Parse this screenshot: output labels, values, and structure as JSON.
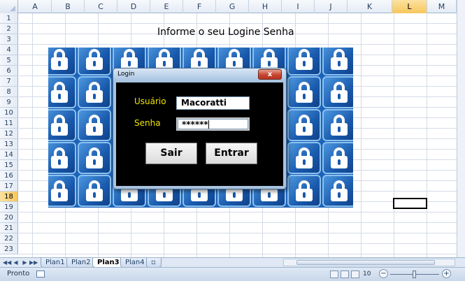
{
  "sheet": {
    "columns": [
      "A",
      "B",
      "C",
      "D",
      "E",
      "F",
      "G",
      "H",
      "I",
      "J",
      "K",
      "L",
      "M"
    ],
    "selected_column": "L",
    "rows": [
      "1",
      "2",
      "3",
      "4",
      "5",
      "6",
      "7",
      "8",
      "9",
      "10",
      "11",
      "12",
      "13",
      "14",
      "15",
      "16",
      "17",
      "18",
      "19",
      "20",
      "21",
      "22",
      "23"
    ],
    "selected_row": "18",
    "heading_text": "Informe  o seu Logine Senha"
  },
  "dialog": {
    "title": "Login",
    "close_glyph": "x",
    "user_label": "Usuário",
    "user_value": "Macoratti",
    "password_label": "Senha",
    "password_value": "******",
    "exit_button": "Sair",
    "enter_button": "Entrar"
  },
  "tabs": {
    "nav_buttons": [
      "◀◀",
      "◀",
      "▶",
      "▶▶"
    ],
    "sheets": [
      {
        "label": "Plan1",
        "active": false
      },
      {
        "label": "Plan2",
        "active": false
      },
      {
        "label": "Plan3",
        "active": true
      },
      {
        "label": "Plan4",
        "active": false
      }
    ]
  },
  "status": {
    "ready_text": "Pronto",
    "zoom_text": "10",
    "zoom_minus": "−",
    "zoom_plus": "+"
  },
  "colors": {
    "label_yellow": "#f2e400",
    "dialog_body": "#000000",
    "selection_header": "#f7c65c",
    "pattern_blue": "#1c62b8"
  }
}
